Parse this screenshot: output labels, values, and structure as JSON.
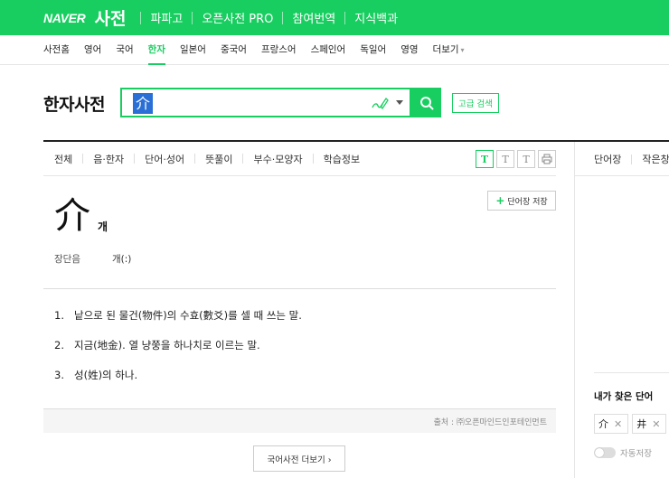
{
  "header": {
    "logo_text": "NAVER",
    "service_name": "사전",
    "menu": [
      "파파고",
      "오픈사전 PRO",
      "참여번역",
      "지식백과"
    ]
  },
  "lang_nav": {
    "items": [
      "사전홈",
      "영어",
      "국어",
      "한자",
      "일본어",
      "중국어",
      "프랑스어",
      "스페인어",
      "독일어",
      "영영",
      "더보기"
    ],
    "active": "한자"
  },
  "search": {
    "page_title": "한자사전",
    "query": "介",
    "advanced_label": "고급 검색"
  },
  "result_tabs": [
    "전체",
    "음·한자",
    "단어·성어",
    "뜻풀이",
    "부수·모양자",
    "학습정보"
  ],
  "font_buttons": [
    "T",
    "T",
    "T"
  ],
  "entry": {
    "save_label": "단어장 저장",
    "hanja": "介",
    "reading": "개",
    "long_short_label": "장단음",
    "long_short_value": "개(:)",
    "definitions": [
      {
        "num": "1.",
        "text": "낱으로 된 물건(物件)의 수효(數爻)를 셀 때 쓰는 말."
      },
      {
        "num": "2.",
        "text": "지금(地金). 열 냥쭝을 하나치로 이르는 말."
      },
      {
        "num": "3.",
        "text": "성(姓)의 하나."
      }
    ],
    "source": "출처 : ㈜오픈마인드인포테인먼트",
    "more_label": "국어사전 더보기 ›"
  },
  "sidebar": {
    "tabs": [
      "단어장",
      "작은창"
    ],
    "recent_title": "내가 찾은 단어",
    "recent_words": [
      "介",
      "井"
    ],
    "autosave_label": "자동저장"
  },
  "colors": {
    "brand_green": "#19ce60",
    "selection_blue": "#2a6fd6"
  }
}
